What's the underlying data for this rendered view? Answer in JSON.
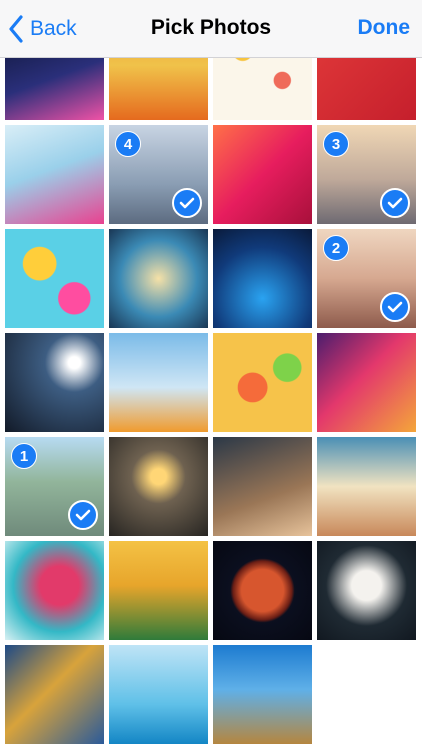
{
  "nav": {
    "back_label": "Back",
    "title": "Pick Photos",
    "done_label": "Done"
  },
  "accent": "#1a7cf5",
  "photos": [
    {
      "id": "p1",
      "icon": "balloons-photo",
      "bg": "linear-gradient(160deg,#0b1330 0%,#2a2f7a 55%,#f052a6 100%)"
    },
    {
      "id": "p2",
      "icon": "sunset-hill-photo",
      "bg": "linear-gradient(180deg,#f3a238 0%,#f0c24a 45%,#e56a1e 100%)"
    },
    {
      "id": "p3",
      "icon": "floral-pattern-photo",
      "bg": "radial-gradient(circle at 30% 30%,#f7c43f 0 10%,transparent 11%),radial-gradient(circle at 70% 60%,#ef6b5a 0 9%,transparent 10%),#fbf6ea"
    },
    {
      "id": "p4",
      "icon": "business-arrow-photo",
      "bg": "linear-gradient(135deg,#e23a3a 0%,#c51f2c 100%)"
    },
    {
      "id": "p5",
      "icon": "splash-runner-photo",
      "bg": "linear-gradient(160deg,#d9eef7 0%,#9ad0ea 45%,#e9418f 100%)"
    },
    {
      "id": "p6",
      "icon": "airport-terminal-photo",
      "bg": "linear-gradient(180deg,#c8d4e3 0%,#8a9db3 60%,#5c6b80 100%)",
      "order": "4"
    },
    {
      "id": "p7",
      "icon": "red-waves-photo",
      "bg": "linear-gradient(135deg,#ff7048 0%,#e71d5e 50%,#a8103b 100%)"
    },
    {
      "id": "p8",
      "icon": "airport-window-photo",
      "bg": "linear-gradient(180deg,#f0d7b5 0%,#bfa99a 55%,#6e6a72 100%)",
      "order": "3"
    },
    {
      "id": "p9",
      "icon": "colorful-balls-photo",
      "bg": "radial-gradient(circle at 35% 35%,#ffce3a 0 18%,transparent 19%),radial-gradient(circle at 70% 70%,#ff4da0 0 16%,transparent 17%),#5ad0e6"
    },
    {
      "id": "p10",
      "icon": "light-tunnel-photo",
      "bg": "radial-gradient(ellipse at center,#f6e1a7 0%,#3b8ab5 55%,#193654 100%)"
    },
    {
      "id": "p11",
      "icon": "confetti-particles-photo",
      "bg": "radial-gradient(circle at 50% 70%,#2aa3f1 0%,#103a7a 60%,#0a1a3a 100%)"
    },
    {
      "id": "p12",
      "icon": "jumping-figure-photo",
      "bg": "linear-gradient(180deg,#efd6c0 0%,#d6a890 50%,#8e5b4c 100%)",
      "order": "2"
    },
    {
      "id": "p13",
      "icon": "hockey-player-photo",
      "bg": "radial-gradient(circle at 70% 30%,#ffffff 0 6%,#3d5d82 30%,#121a28 100%)"
    },
    {
      "id": "p14",
      "icon": "air-show-jets-photo",
      "bg": "linear-gradient(180deg,#7bbbe8 0%,#cfe6f5 55%,#f09b2e 100%)"
    },
    {
      "id": "p15",
      "icon": "candies-photo",
      "bg": "radial-gradient(circle at 40% 55%,#f56b3a 0 18%,transparent 19%),radial-gradient(circle at 75% 35%,#7ed24a 0 14%,transparent 15%),#f6c34a"
    },
    {
      "id": "p16",
      "icon": "paint-swirl-photo",
      "bg": "linear-gradient(135deg,#4b1d6d 0%,#e3386c 45%,#f4a63a 100%)"
    },
    {
      "id": "p17",
      "icon": "hallstatt-village-photo",
      "bg": "linear-gradient(180deg,#b7dbf2 0%,#92b59b 45%,#6f8a7b 100%)",
      "order": "1"
    },
    {
      "id": "p18",
      "icon": "lightbulb-brain-photo",
      "bg": "radial-gradient(circle at 50% 40%,#ffd676 0 10%,#6e6150 35%,#272522 100%)"
    },
    {
      "id": "p19",
      "icon": "dna-helix-photo",
      "bg": "linear-gradient(160deg,#2b3847 0%,#9a7656 60%,#e7c39b 100%)"
    },
    {
      "id": "p20",
      "icon": "sunset-mountains-photo",
      "bg": "linear-gradient(180deg,#4a8fb5 0%,#f1e3c1 50%,#c8885a 100%)"
    },
    {
      "id": "p21",
      "icon": "ink-cloud-photo",
      "bg": "radial-gradient(circle at 55% 45%,#e23a6a 0 25%,#33b8c6 60%,#d8f1f3 100%)"
    },
    {
      "id": "p22",
      "icon": "soccer-player-photo",
      "bg": "linear-gradient(180deg,#f4c245 0%,#e7a52b 45%,#2f7b3a 100%)"
    },
    {
      "id": "p23",
      "icon": "planet-mars-photo",
      "bg": "radial-gradient(circle at 50% 50%,#d7562e 0 30%,#6a1e15 42%,#0b0f1f 46%,#060812 100%)"
    },
    {
      "id": "p24",
      "icon": "into-the-wild-photo",
      "bg": "radial-gradient(circle at 50% 45%,#f4f2ee 0 20%,#1f2a33 55%,#111820 100%)"
    },
    {
      "id": "p25",
      "icon": "abstract-blur-photo",
      "bg": "linear-gradient(135deg,#1e4a86 0%,#d8a33b 45%,#2a5a9a 100%)"
    },
    {
      "id": "p26",
      "icon": "yellow-boat-photo",
      "bg": "linear-gradient(180deg,#bfe4f6 0%,#5fc0e8 60%,#1386c5 100%)"
    },
    {
      "id": "p27",
      "icon": "temple-columns-photo",
      "bg": "linear-gradient(180deg,#1d7bd0 0%,#5fb0e8 45%,#b5863f 100%)"
    }
  ]
}
